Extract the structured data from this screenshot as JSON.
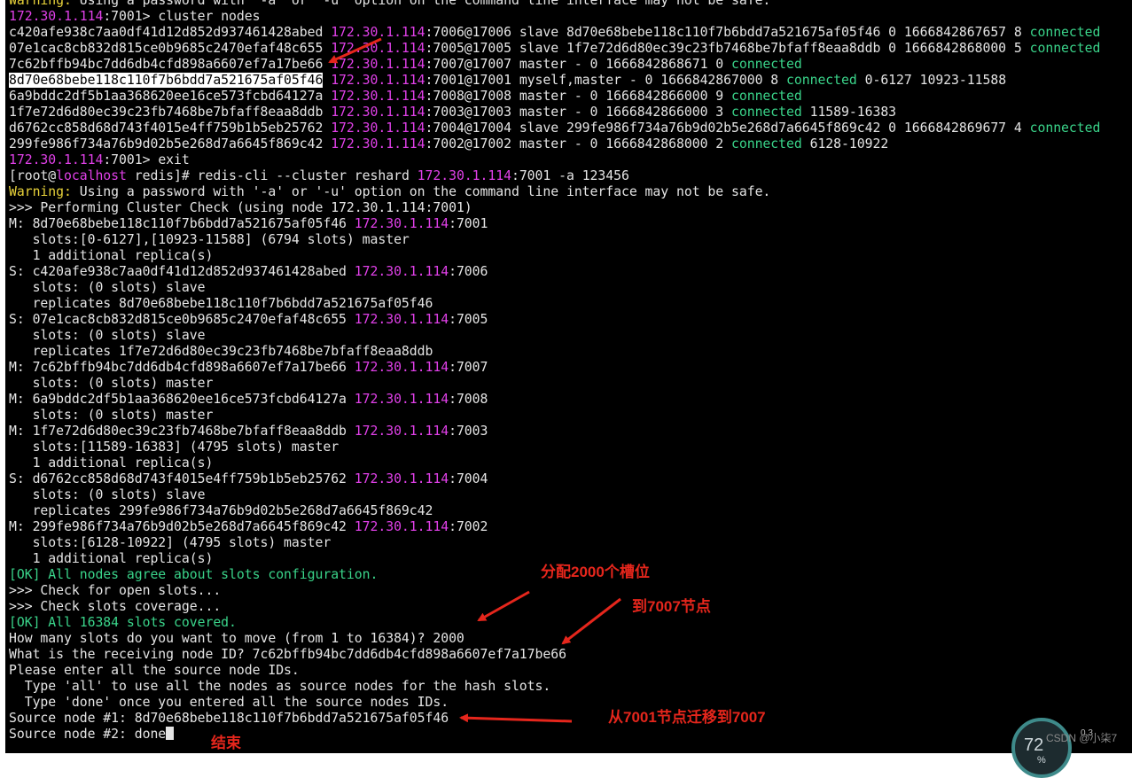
{
  "terminal": {
    "lines": [
      [
        {
          "t": "Warning: ",
          "c": "yel"
        },
        {
          "t": "Using a password with '-a' or '-u' option on the command line interface may not be safe."
        }
      ],
      [
        {
          "t": "172.30.1.114",
          "c": "ip"
        },
        {
          "t": ":7001> cluster nodes"
        }
      ],
      [
        {
          "t": "c420afe938c7aa0df41d12d852d937461428abed "
        },
        {
          "t": "172.30.1.114",
          "c": "ip"
        },
        {
          "t": ":7006@17006 slave 8d70e68bebe118c110f7b6bdd7a521675af05f46 0 1666842867657 8 "
        },
        {
          "t": "connected",
          "c": "grn"
        }
      ],
      [
        {
          "t": "07e1cac8cb832d815ce0b9685c2470efaf48c655 "
        },
        {
          "t": "172.30.1.114",
          "c": "ip"
        },
        {
          "t": ":7005@17005 slave 1f7e72d6d80ec39c23fb7468be7bfaff8eaa8ddb 0 1666842868000 5 "
        },
        {
          "t": "connected",
          "c": "grn"
        }
      ],
      [
        {
          "t": "7c62bffb94bc7dd6db4cfd898a6607ef7a17be66 "
        },
        {
          "t": "172.30.1.114",
          "c": "ip"
        },
        {
          "t": ":7007@17007 master - 0 1666842868671 0 "
        },
        {
          "t": "connected",
          "c": "grn"
        }
      ],
      [
        {
          "t": "8d70e68bebe118c110f7b6bdd7a521675af05f46",
          "c": "sel"
        },
        {
          "t": " "
        },
        {
          "t": "172.30.1.114",
          "c": "ip"
        },
        {
          "t": ":7001@17001 myself,master - 0 1666842867000 8 "
        },
        {
          "t": "connected",
          "c": "grn"
        },
        {
          "t": " 0-6127 10923-11588"
        }
      ],
      [
        {
          "t": "6a9bddc2df5b1aa368620ee16ce573fcbd64127a "
        },
        {
          "t": "172.30.1.114",
          "c": "ip"
        },
        {
          "t": ":7008@17008 master - 0 1666842866000 9 "
        },
        {
          "t": "connected",
          "c": "grn"
        }
      ],
      [
        {
          "t": "1f7e72d6d80ec39c23fb7468be7bfaff8eaa8ddb "
        },
        {
          "t": "172.30.1.114",
          "c": "ip"
        },
        {
          "t": ":7003@17003 master - 0 1666842866000 3 "
        },
        {
          "t": "connected",
          "c": "grn"
        },
        {
          "t": " 11589-16383"
        }
      ],
      [
        {
          "t": "d6762cc858d68d743f4015e4ff759b1b5eb25762 "
        },
        {
          "t": "172.30.1.114",
          "c": "ip"
        },
        {
          "t": ":7004@17004 slave 299fe986f734a76b9d02b5e268d7a6645f869c42 0 1666842869677 4 "
        },
        {
          "t": "connected",
          "c": "grn"
        }
      ],
      [
        {
          "t": "299fe986f734a76b9d02b5e268d7a6645f869c42 "
        },
        {
          "t": "172.30.1.114",
          "c": "ip"
        },
        {
          "t": ":7002@17002 master - 0 1666842868000 2 "
        },
        {
          "t": "connected",
          "c": "grn"
        },
        {
          "t": " 6128-10922"
        }
      ],
      [
        {
          "t": "172.30.1.114",
          "c": "ip"
        },
        {
          "t": ":7001> exit"
        }
      ],
      [
        {
          "t": "[root@"
        },
        {
          "t": "localhost",
          "c": "ip"
        },
        {
          "t": " redis]# redis-cli --cluster reshard "
        },
        {
          "t": "172.30.1.114",
          "c": "ip"
        },
        {
          "t": ":7001 -a 123456"
        }
      ],
      [
        {
          "t": "Warning: ",
          "c": "yel"
        },
        {
          "t": "Using a password with '-a' or '-u' option on the command line interface may not be safe."
        }
      ],
      [
        {
          "t": ">>> Performing Cluster Check (using node 172.30.1.114:7001)"
        }
      ],
      [
        {
          "t": "M: 8d70e68bebe118c110f7b6bdd7a521675af05f46 "
        },
        {
          "t": "172.30.1.114",
          "c": "ip"
        },
        {
          "t": ":7001"
        }
      ],
      [
        {
          "t": "   slots:[0-6127],[10923-11588] (6794 slots) master"
        }
      ],
      [
        {
          "t": "   1 additional replica(s)"
        }
      ],
      [
        {
          "t": "S: c420afe938c7aa0df41d12d852d937461428abed "
        },
        {
          "t": "172.30.1.114",
          "c": "ip"
        },
        {
          "t": ":7006"
        }
      ],
      [
        {
          "t": "   slots: (0 slots) slave"
        }
      ],
      [
        {
          "t": "   replicates 8d70e68bebe118c110f7b6bdd7a521675af05f46"
        }
      ],
      [
        {
          "t": "S: 07e1cac8cb832d815ce0b9685c2470efaf48c655 "
        },
        {
          "t": "172.30.1.114",
          "c": "ip"
        },
        {
          "t": ":7005"
        }
      ],
      [
        {
          "t": "   slots: (0 slots) slave"
        }
      ],
      [
        {
          "t": "   replicates 1f7e72d6d80ec39c23fb7468be7bfaff8eaa8ddb"
        }
      ],
      [
        {
          "t": "M: 7c62bffb94bc7dd6db4cfd898a6607ef7a17be66 "
        },
        {
          "t": "172.30.1.114",
          "c": "ip"
        },
        {
          "t": ":7007"
        }
      ],
      [
        {
          "t": "   slots: (0 slots) master"
        }
      ],
      [
        {
          "t": "M: 6a9bddc2df5b1aa368620ee16ce573fcbd64127a "
        },
        {
          "t": "172.30.1.114",
          "c": "ip"
        },
        {
          "t": ":7008"
        }
      ],
      [
        {
          "t": "   slots: (0 slots) master"
        }
      ],
      [
        {
          "t": "M: 1f7e72d6d80ec39c23fb7468be7bfaff8eaa8ddb "
        },
        {
          "t": "172.30.1.114",
          "c": "ip"
        },
        {
          "t": ":7003"
        }
      ],
      [
        {
          "t": "   slots:[11589-16383] (4795 slots) master"
        }
      ],
      [
        {
          "t": "   1 additional replica(s)"
        }
      ],
      [
        {
          "t": "S: d6762cc858d68d743f4015e4ff759b1b5eb25762 "
        },
        {
          "t": "172.30.1.114",
          "c": "ip"
        },
        {
          "t": ":7004"
        }
      ],
      [
        {
          "t": "   slots: (0 slots) slave"
        }
      ],
      [
        {
          "t": "   replicates 299fe986f734a76b9d02b5e268d7a6645f869c42"
        }
      ],
      [
        {
          "t": "M: 299fe986f734a76b9d02b5e268d7a6645f869c42 "
        },
        {
          "t": "172.30.1.114",
          "c": "ip"
        },
        {
          "t": ":7002"
        }
      ],
      [
        {
          "t": "   slots:[6128-10922] (4795 slots) master"
        }
      ],
      [
        {
          "t": "   1 additional replica(s)"
        }
      ],
      [
        {
          "t": "[OK] All nodes agree about slots configuration.",
          "c": "grn"
        }
      ],
      [
        {
          "t": ">>> Check for open slots..."
        }
      ],
      [
        {
          "t": ">>> Check slots coverage..."
        }
      ],
      [
        {
          "t": "[OK] All 16384 slots covered.",
          "c": "grn"
        }
      ],
      [
        {
          "t": "How many slots do you want to move (from 1 to 16384)? 2000"
        }
      ],
      [
        {
          "t": "What is the receiving node ID? 7c62bffb94bc7dd6db4cfd898a6607ef7a17be66"
        }
      ],
      [
        {
          "t": "Please enter all the source node IDs."
        }
      ],
      [
        {
          "t": "  Type 'all' to use all the nodes as source nodes for the hash slots."
        }
      ],
      [
        {
          "t": "  Type 'done' once you entered all the source nodes IDs."
        }
      ],
      [
        {
          "t": "Source node #1: 8d70e68bebe118c110f7b6bdd7a521675af05f46"
        }
      ],
      [
        {
          "t": "Source node #2: done"
        },
        {
          "t": "",
          "c": "cursor"
        }
      ]
    ]
  },
  "annotations": {
    "allocate": "分配2000个槽位",
    "to_node": "到7007节点",
    "migrate": "从7001节点迁移到7007",
    "end": "结束"
  },
  "overlay": {
    "percent": "72",
    "percent_sign": "%",
    "watermark": "CSDN @小柒7",
    "speed": "0.3"
  },
  "colors": {
    "ip": "#e040e8",
    "connected": "#3ad48a",
    "warning": "#e8d23a",
    "annotation": "#e5261c"
  }
}
